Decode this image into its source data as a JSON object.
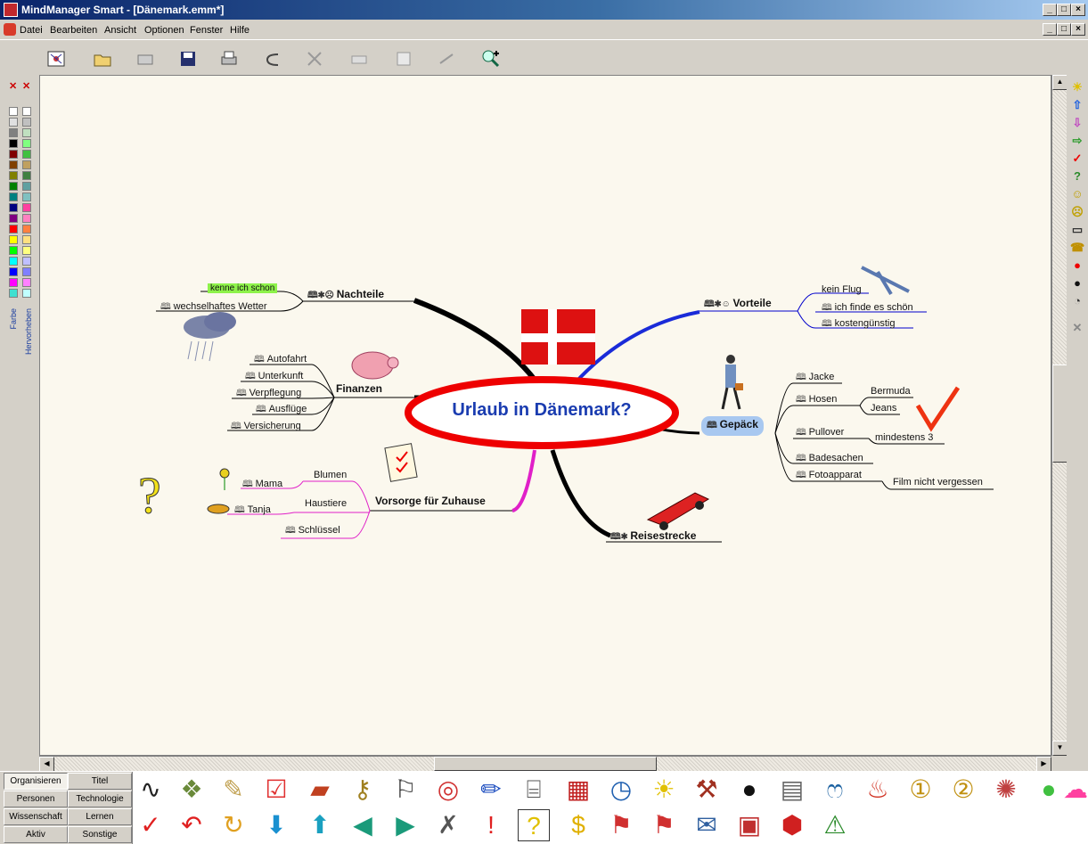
{
  "window": {
    "title": "MindManager Smart - [Dänemark.emm*]",
    "min": "_",
    "max": "□",
    "close": "×"
  },
  "menu": [
    "Datei",
    "Bearbeiten",
    "Ansicht",
    "Optionen",
    "Fenster",
    "Hilfe"
  ],
  "toolbar": [
    "new-map",
    "open",
    "link",
    "save",
    "print",
    "undo",
    "cut",
    "copy",
    "paste",
    "redo",
    "zoom-in"
  ],
  "left_panel": {
    "tab_farbe": "Farbe",
    "tab_hervorheben": "Hervorheben"
  },
  "map": {
    "central": "Urlaub in Dänemark?",
    "nachteile": {
      "label": "Nachteile",
      "items": [
        "kenne ich schon",
        "wechselhaftes Wetter"
      ]
    },
    "vorteile": {
      "label": "Vorteile",
      "items": [
        "kein Flug",
        "ich finde es schön",
        "kostengünstig"
      ]
    },
    "finanzen": {
      "label": "Finanzen",
      "items": [
        "Autofahrt",
        "Unterkunft",
        "Verpflegung",
        "Ausflüge",
        "Versicherung"
      ]
    },
    "gepaeck": {
      "label": "Gepäck",
      "items": [
        "Jacke",
        "Hosen",
        "Pullover",
        "Badesachen",
        "Fotoapparat"
      ],
      "hosen_sub": [
        "Bermuda",
        "Jeans"
      ],
      "pullover_sub": "mindestens 3",
      "foto_sub": "Film nicht vergessen"
    },
    "vorsorge": {
      "label": "Vorsorge für Zuhause",
      "items": [
        "Blumen",
        "Haustiere",
        "Schlüssel"
      ],
      "blumen_sub": "Mama",
      "haustiere_sub": "Tanja"
    },
    "reisestrecke": {
      "label": "Reisestrecke"
    }
  },
  "category_tabs": [
    [
      "Organisieren",
      "Titel"
    ],
    [
      "Personen",
      "Technologie"
    ],
    [
      "Wissenschaft",
      "Lernen"
    ],
    [
      "Aktiv",
      "Sonstige"
    ]
  ],
  "gallery_row1": [
    "line-icon",
    "money-icon",
    "map-icon",
    "checklist-icon",
    "book-icon",
    "keys-icon",
    "runner-icon",
    "target-icon",
    "pencil-icon",
    "ladder-icon",
    "calendar-icon",
    "clock-icon",
    "bulb-icon",
    "hammer-icon",
    "bomb-icon",
    "paper-icon",
    "snake-icon",
    "hot-icon",
    "first-place-icon",
    "second-place-icon",
    "explosion-icon",
    "speech-bubble-icon",
    "thought-bubble-icon"
  ],
  "gallery_row2": [
    "check-icon",
    "u-turn-icon",
    "refresh-icon",
    "arrow-down-icon",
    "arrow-up-icon",
    "arrow-left-icon",
    "arrow-right-icon",
    "cross-icon",
    "exclamation-icon",
    "question-icon",
    "dollar-icon",
    "start-flag-icon",
    "finish-flag-icon",
    "email-icon",
    "monitor-icon",
    "stop-icon",
    "traffic-light-icon"
  ]
}
